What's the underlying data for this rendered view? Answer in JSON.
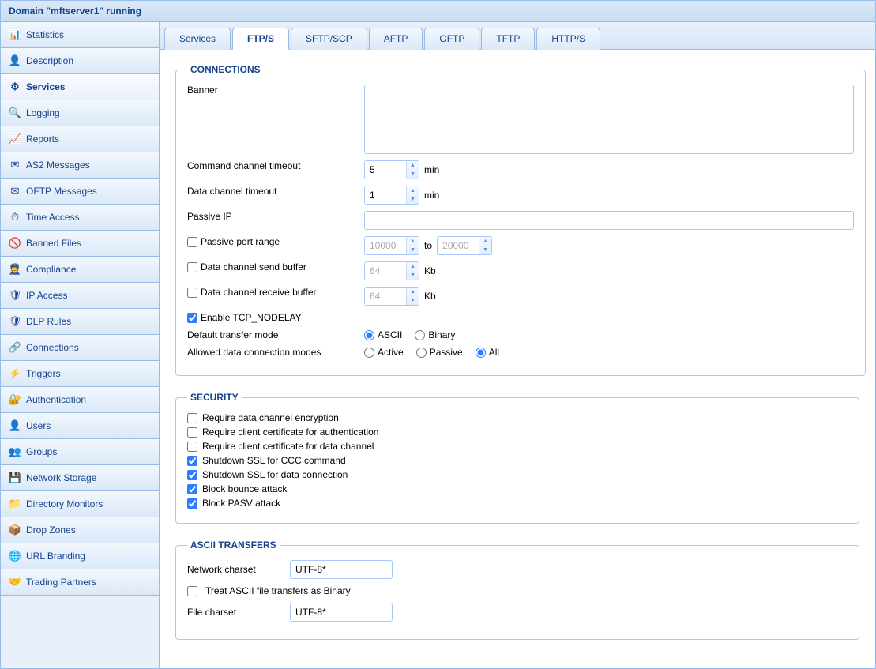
{
  "title": "Domain \"mftserver1\" running",
  "sidebar": {
    "items": [
      {
        "label": "Statistics",
        "icon": "📊"
      },
      {
        "label": "Description",
        "icon": "👤"
      },
      {
        "label": "Services",
        "icon": "⚙",
        "active": true
      },
      {
        "label": "Logging",
        "icon": "🔍"
      },
      {
        "label": "Reports",
        "icon": "📈"
      },
      {
        "label": "AS2 Messages",
        "icon": "✉"
      },
      {
        "label": "OFTP Messages",
        "icon": "✉"
      },
      {
        "label": "Time Access",
        "icon": "⏱"
      },
      {
        "label": "Banned Files",
        "icon": "🚫"
      },
      {
        "label": "Compliance",
        "icon": "👮"
      },
      {
        "label": "IP Access",
        "icon": "🛡"
      },
      {
        "label": "DLP Rules",
        "icon": "🛡"
      },
      {
        "label": "Connections",
        "icon": "🔗"
      },
      {
        "label": "Triggers",
        "icon": "⚡"
      },
      {
        "label": "Authentication",
        "icon": "🔐"
      },
      {
        "label": "Users",
        "icon": "👤"
      },
      {
        "label": "Groups",
        "icon": "👥"
      },
      {
        "label": "Network Storage",
        "icon": "💾"
      },
      {
        "label": "Directory Monitors",
        "icon": "📁"
      },
      {
        "label": "Drop Zones",
        "icon": "📦"
      },
      {
        "label": "URL Branding",
        "icon": "🌐"
      },
      {
        "label": "Trading Partners",
        "icon": "🤝"
      }
    ]
  },
  "tabs": [
    {
      "label": "Services"
    },
    {
      "label": "FTP/S",
      "active": true
    },
    {
      "label": "SFTP/SCP"
    },
    {
      "label": "AFTP"
    },
    {
      "label": "OFTP"
    },
    {
      "label": "TFTP"
    },
    {
      "label": "HTTP/S"
    }
  ],
  "connections": {
    "legend": "CONNECTIONS",
    "banner_label": "Banner",
    "banner_value": "",
    "cmd_timeout_label": "Command channel timeout",
    "cmd_timeout_value": "5",
    "cmd_timeout_unit": "min",
    "data_timeout_label": "Data channel timeout",
    "data_timeout_value": "1",
    "data_timeout_unit": "min",
    "passive_ip_label": "Passive IP",
    "passive_ip_value": "",
    "passive_port_label": "Passive port range",
    "passive_port_from": "10000",
    "passive_port_to_label": "to",
    "passive_port_to": "20000",
    "send_buf_label": "Data channel send buffer",
    "send_buf_value": "64",
    "send_buf_unit": "Kb",
    "recv_buf_label": "Data channel receive buffer",
    "recv_buf_value": "64",
    "recv_buf_unit": "Kb",
    "tcp_nodelay_label": "Enable TCP_NODELAY",
    "transfer_mode_label": "Default transfer mode",
    "transfer_ascii": "ASCII",
    "transfer_binary": "Binary",
    "conn_modes_label": "Allowed data connection modes",
    "conn_active": "Active",
    "conn_passive": "Passive",
    "conn_all": "All"
  },
  "security": {
    "legend": "SECURITY",
    "req_data_enc": "Require data channel encryption",
    "req_client_cert_auth": "Require client certificate for authentication",
    "req_client_cert_data": "Require client certificate for data channel",
    "shutdown_ccc": "Shutdown SSL for CCC command",
    "shutdown_data": "Shutdown SSL for data connection",
    "block_bounce": "Block bounce attack",
    "block_pasv": "Block PASV attack"
  },
  "ascii": {
    "legend": "ASCII TRANSFERS",
    "net_charset_label": "Network charset",
    "net_charset_value": "UTF-8*",
    "treat_binary_label": "Treat ASCII file transfers as Binary",
    "file_charset_label": "File charset",
    "file_charset_value": "UTF-8*"
  }
}
